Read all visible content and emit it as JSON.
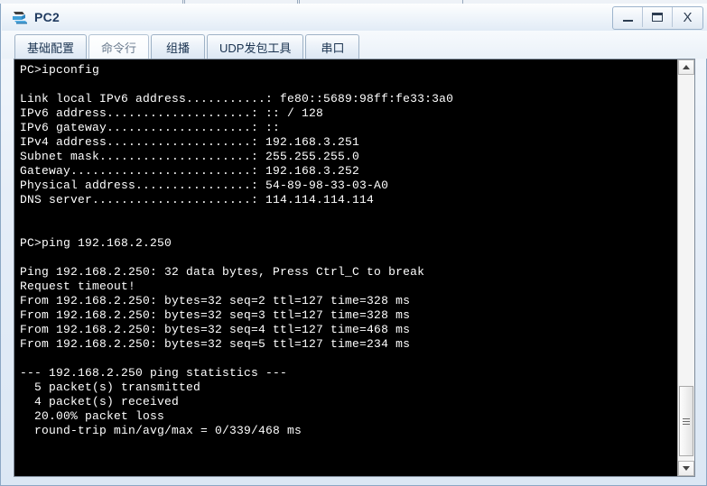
{
  "window": {
    "title": "PC2",
    "app_icon": "pc-device-icon",
    "controls": [
      {
        "name": "minimize-button",
        "glyph": "—"
      },
      {
        "name": "maximize-button",
        "glyph": "□"
      },
      {
        "name": "close-button",
        "glyph": "X"
      }
    ]
  },
  "tabs": [
    {
      "label": "基础配置",
      "active": false
    },
    {
      "label": "命令行",
      "active": true
    },
    {
      "label": "组播",
      "active": false
    },
    {
      "label": "UDP发包工具",
      "active": false
    },
    {
      "label": "串口",
      "active": false
    }
  ],
  "console": {
    "background": "#000000",
    "foreground": "#ffffff",
    "lines": [
      "PC>ipconfig",
      "",
      "Link local IPv6 address...........: fe80::5689:98ff:fe33:3a0",
      "IPv6 address....................: :: / 128",
      "IPv6 gateway....................: ::",
      "IPv4 address....................: 192.168.3.251",
      "Subnet mask.....................: 255.255.255.0",
      "Gateway.........................: 192.168.3.252",
      "Physical address................: 54-89-98-33-03-A0",
      "DNS server......................: 114.114.114.114",
      "",
      "",
      "PC>ping 192.168.2.250",
      "",
      "Ping 192.168.2.250: 32 data bytes, Press Ctrl_C to break",
      "Request timeout!",
      "From 192.168.2.250: bytes=32 seq=2 ttl=127 time=328 ms",
      "From 192.168.2.250: bytes=32 seq=3 ttl=127 time=328 ms",
      "From 192.168.2.250: bytes=32 seq=4 ttl=127 time=468 ms",
      "From 192.168.2.250: bytes=32 seq=5 ttl=127 time=234 ms",
      "",
      "--- 192.168.2.250 ping statistics ---",
      "  5 packet(s) transmitted",
      "  4 packet(s) received",
      "  20.00% packet loss",
      "  round-trip min/avg/max = 0/339/468 ms"
    ]
  },
  "scrollbar": {
    "up_arrow": "scroll-up-arrow",
    "down_arrow": "scroll-down-arrow",
    "thumb": "scroll-thumb"
  }
}
